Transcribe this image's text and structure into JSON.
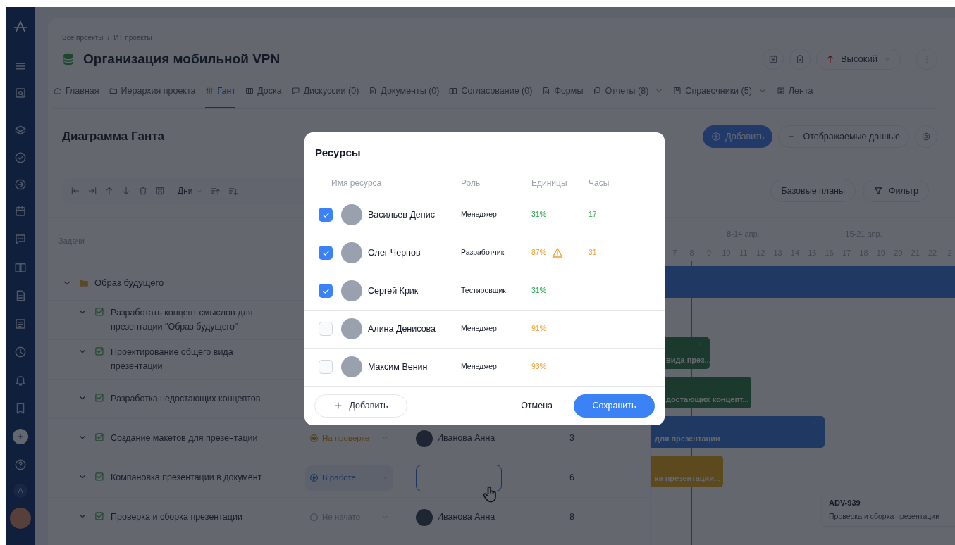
{
  "breadcrumbs": [
    "Все проекты",
    "ИТ проекты"
  ],
  "breadcrumb_separator": "/",
  "project": {
    "title": "Организация мобильной VPN",
    "priority": "Высокий"
  },
  "tabs": [
    {
      "label": "Главная",
      "selected": false,
      "dropdown": false
    },
    {
      "label": "Иерархия проекта",
      "selected": false,
      "dropdown": false
    },
    {
      "label": "Гант",
      "selected": true,
      "dropdown": false
    },
    {
      "label": "Доска",
      "selected": false,
      "dropdown": false
    },
    {
      "label": "Дискуссии (0)",
      "selected": false,
      "dropdown": false
    },
    {
      "label": "Документы (0)",
      "selected": false,
      "dropdown": false
    },
    {
      "label": "Согласование (0)",
      "selected": false,
      "dropdown": false
    },
    {
      "label": "Формы",
      "selected": false,
      "dropdown": false
    },
    {
      "label": "Отчеты (8)",
      "selected": false,
      "dropdown": true
    },
    {
      "label": "Справочники (5)",
      "selected": false,
      "dropdown": true
    },
    {
      "label": "Лента",
      "selected": false,
      "dropdown": false
    }
  ],
  "section": {
    "title": "Диаграмма Ганта",
    "add_button": "Добавить",
    "fields_button": "Отображаемые данные"
  },
  "toolbar": {
    "scale": "Дни",
    "baselines_button": "Базовые планы",
    "filter_button": "Фильтр"
  },
  "tasks_table": {
    "column": "Задачи",
    "group": {
      "title": "Образ будущего",
      "expanded": true,
      "children": [
        {
          "title": "Разработать концепт смыслов для презентации \"Образ будущего\"",
          "expanded": true
        },
        {
          "title": "Проектирование общего вида презентации",
          "expanded": true,
          "bar": {
            "label": "вида през..."
          }
        },
        {
          "title": "Разработка недостающих концептов",
          "expanded": true,
          "bar": {
            "label": "достающих концепт..."
          }
        },
        {
          "title": "Создание макетов для презентации",
          "expanded": true,
          "status": {
            "label": "На проверке",
            "kind": "review"
          },
          "assignee": "Иванова Анна",
          "assignee_editing": false,
          "estimate": "3",
          "bar": {
            "label": "для презентации"
          }
        },
        {
          "title": "Компановка презентации в документ",
          "expanded": true,
          "status": {
            "label": "В работе",
            "kind": "in_progress"
          },
          "assignee_editing": true,
          "estimate": "6",
          "bar": {
            "label": "ка презентации..."
          }
        },
        {
          "title": "Проверка и сборка презентации",
          "expanded": true,
          "status": {
            "label": "Не начато",
            "kind": "not_started"
          },
          "assignee": "Иванова Анна",
          "assignee_editing": false,
          "estimate": "8"
        }
      ]
    }
  },
  "timeline": {
    "weeks": [
      "8-14 апр.",
      "15-21 апр."
    ],
    "days": [
      "7",
      "8",
      "9",
      "10",
      "11",
      "12",
      "13",
      "14",
      "15",
      "16",
      "17",
      "18",
      "19",
      "20",
      "21",
      "22",
      "2"
    ],
    "tooltip": {
      "id": "ADV-939",
      "title": "Проверка и сборка презентации"
    }
  },
  "resources_dialog": {
    "title": "Ресурсы",
    "columns": [
      "Имя ресурса",
      "Роль",
      "Единицы",
      "Часы"
    ],
    "rows": [
      {
        "name": "Васильев Денис",
        "role": "Менеджер",
        "units": "31%",
        "hours": "17",
        "checked": true,
        "high_load": false,
        "warning": false
      },
      {
        "name": "Олег Чернов",
        "role": "Разработчик",
        "units": "87%",
        "hours": "31",
        "checked": true,
        "high_load": true,
        "warning": true
      },
      {
        "name": "Сергей Крик",
        "role": "Тестировщик",
        "units": "31%",
        "checked": true,
        "high_load": false,
        "warning": false
      },
      {
        "name": "Алина Денисова",
        "role": "Менеджер",
        "units": "91%",
        "checked": false,
        "high_load": true,
        "warning": false
      },
      {
        "name": "Максим Венин",
        "role": "Менеджер",
        "units": "93%",
        "checked": false,
        "high_load": true,
        "warning": false
      }
    ],
    "add_button": "Добавить",
    "cancel_button": "Отмена",
    "save_button": "Сохранить"
  }
}
